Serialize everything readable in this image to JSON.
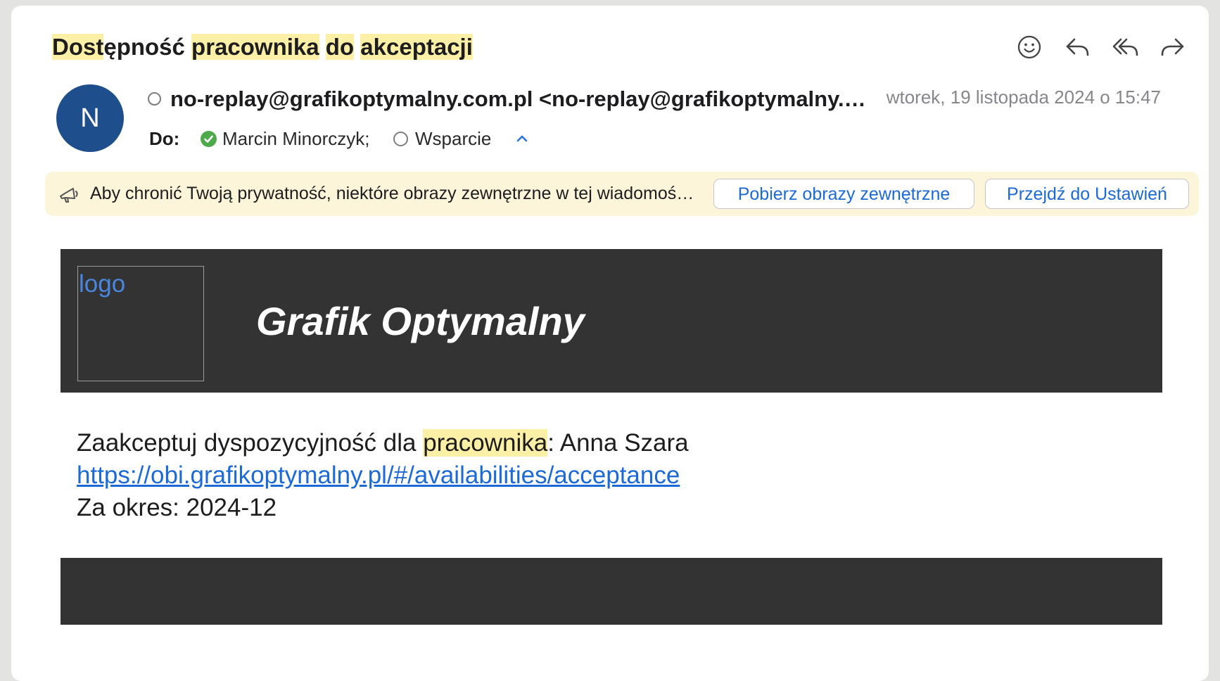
{
  "message": {
    "subject_parts": [
      "Dost",
      "ępność ",
      "pracownika",
      " ",
      "do",
      " ",
      "akceptacji"
    ],
    "sender": "no-replay@grafikoptymalny.com.pl <no-replay@grafikoptymalny.com.pl>",
    "avatar_initial": "N",
    "date": "wtorek, 19 listopada 2024 o 15:47",
    "to_label": "Do:",
    "recipients": [
      "Marcin Minorczyk;",
      "Wsparcie"
    ]
  },
  "icons": {
    "actions": [
      "emoji-reaction-icon",
      "reply-icon",
      "reply-all-icon",
      "forward-icon"
    ],
    "banner": "privacy-speaker-icon",
    "recipient_status": [
      "verified-check-icon",
      "status-ring-icon"
    ],
    "expand": "chevron-up-icon"
  },
  "privacy_banner": {
    "text": "Aby chronić Twoją prywatność, niektóre obrazy zewnętrzne w tej wiadomości zostały zablokowane.",
    "download_button": "Pobierz obrazy zewnętrzne",
    "settings_button": "Przejdź do Ustawień"
  },
  "email_content": {
    "logo_alt": "logo",
    "brand": "Grafik Optymalny",
    "line1_pre": "Zaakceptuj dyspozycyjność dla ",
    "line1_hl": "pracownika",
    "line1_post": ": Anna Szara",
    "link": "https://obi.grafikoptymalny.pl/#/availabilities/acceptance",
    "period": "Za okres: 2024-12"
  },
  "colors": {
    "highlight": "#fcefa6",
    "avatar": "#1f4e8c",
    "link": "#1c6ad6",
    "banner_bg": "#fdf5d9",
    "email_header_bg": "#333333",
    "verified": "#4ea94b"
  }
}
